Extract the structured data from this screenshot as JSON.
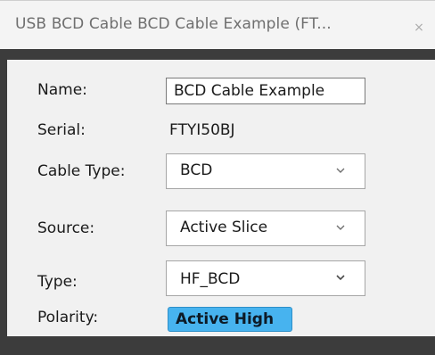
{
  "window": {
    "tab_title": "USB BCD Cable BCD Cable Example (FT...",
    "close_glyph": "×",
    "frame_color": "#3c3c3c",
    "panel_color": "#f1f1f1"
  },
  "form": {
    "name": {
      "label": "Name:",
      "value": "BCD Cable Example"
    },
    "serial": {
      "label": "Serial:",
      "value": "FTYI50BJ"
    },
    "cable_type": {
      "label": "Cable Type:",
      "selected": "BCD",
      "icon": "chevron-down-icon"
    },
    "source": {
      "label": "Source:",
      "selected": "Active Slice",
      "icon": "chevron-down-icon"
    },
    "type": {
      "label": "Type:",
      "selected": "HF_BCD",
      "icon": "chevron-down-icon"
    },
    "polarity": {
      "label": "Polarity:",
      "value": "Active High",
      "color": "#47b3ef"
    }
  }
}
